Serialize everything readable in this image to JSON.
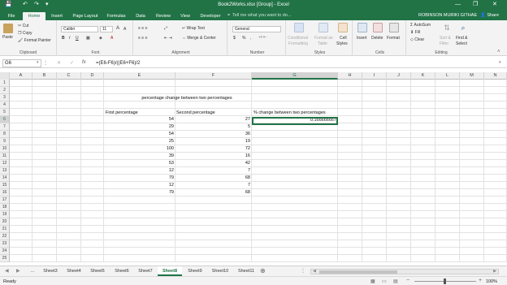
{
  "window": {
    "title": "Book2Works.xlsx [Group] - Excel",
    "user": "ROBINSON MURIKI GITHAE",
    "share_label": "Share",
    "minimize_glyph": "—",
    "restore_glyph": "❐",
    "close_glyph": "✕",
    "save_glyph": "💾",
    "undo_glyph": "↶",
    "redo_glyph": "↷",
    "customize_glyph": "▾"
  },
  "ribbon_tabs": [
    "File",
    "Home",
    "Insert",
    "Page Layout",
    "Formulas",
    "Data",
    "Review",
    "View",
    "Developer"
  ],
  "tell_me": "Tell me what you want to do...",
  "ribbon": {
    "clipboard": {
      "paste": "Paste",
      "cut": "Cut",
      "copy": "Copy",
      "format_painter": "Format Painter",
      "label": "Clipboard"
    },
    "font": {
      "name": "Calibri",
      "size": "11",
      "grow": "A",
      "shrink": "A",
      "bold": "B",
      "italic": "I",
      "underline": "U",
      "label": "Font"
    },
    "alignment": {
      "wrap": "Wrap Text",
      "merge": "Merge & Center",
      "label": "Alignment"
    },
    "number": {
      "format": "General",
      "currency": "$",
      "percent": "%",
      "comma": ",",
      "label": "Number"
    },
    "styles": {
      "conditional": "Conditional",
      "conditional2": "Formatting",
      "format_as": "Format as",
      "format_as2": "Table",
      "cell_styles": "Cell",
      "cell_styles2": "Styles",
      "label": "Styles"
    },
    "cells": {
      "insert": "Insert",
      "delete": "Delete",
      "format": "Format",
      "label": "Cells"
    },
    "editing": {
      "autosum": "AutoSum",
      "fill": "Fill",
      "clear": "Clear",
      "sort": "Sort &",
      "sort2": "Filter",
      "find": "Find &",
      "find2": "Select",
      "label": "Editing"
    }
  },
  "formula_bar": {
    "name_box": "G6",
    "fx": "fx",
    "formula": "=(E6-F6)/((E6+F6)/2"
  },
  "columns": [
    "A",
    "B",
    "C",
    "D",
    "E",
    "F",
    "G",
    "H",
    "I",
    "J",
    "K",
    "L",
    "M",
    "N"
  ],
  "rows": [
    "1",
    "2",
    "3",
    "4",
    "5",
    "6",
    "7",
    "8",
    "9",
    "10",
    "11",
    "12",
    "13",
    "14",
    "15",
    "16",
    "17",
    "18",
    "19",
    "20",
    "21",
    "22",
    "23",
    "24",
    "25"
  ],
  "sheet": {
    "title": "percentage change between two percentages",
    "headers": {
      "e": "First percentage",
      "f": "Second percentage",
      "g": "% change between two percentages"
    },
    "e_values": [
      "54",
      "29",
      "54",
      "25",
      "100",
      "39",
      "53",
      "12",
      "79",
      "12",
      "79"
    ],
    "f_values": [
      "27",
      "5",
      "36",
      "19",
      "72",
      "16",
      "42",
      "7",
      "68",
      "7",
      "68"
    ],
    "g6": "0.166666667"
  },
  "sheet_tabs": [
    "...",
    "Sheet3",
    "Sheet4",
    "Sheet5",
    "Sheet6",
    "Sheet7",
    "Sheet8",
    "Sheet9",
    "Sheet10",
    "Sheet11"
  ],
  "active_sheet": "Sheet8",
  "status": {
    "ready": "Ready",
    "zoom": "100%"
  },
  "colors": {
    "accent": "#217346"
  }
}
